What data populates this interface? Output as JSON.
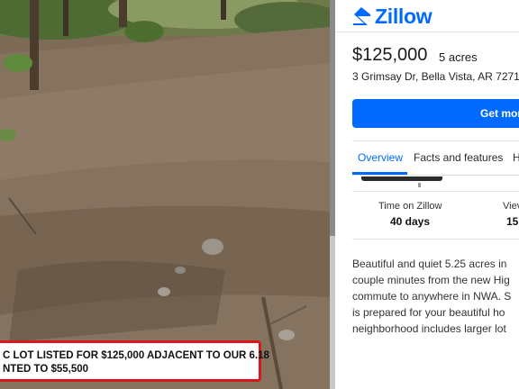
{
  "caption": {
    "line1": "C LOT LISTED FOR $125,000 ADJACENT TO OUR 6.18",
    "line2": "NTED TO $55,500"
  },
  "zillow": {
    "brand": "Zillow",
    "price": "$125,000",
    "acres": "5 acres",
    "address": "3 Grimsay Dr, Bella Vista, AR 7271",
    "cta_label": "Get mor",
    "tabs": [
      "Overview",
      "Facts and features",
      "H"
    ],
    "active_tab": "Overview",
    "stats": [
      {
        "label": "Time on Zillow",
        "value": "40 days"
      },
      {
        "label": "Viev",
        "value": "15"
      }
    ],
    "description_lines": [
      "Beautiful and quiet 5.25 acres in",
      "couple minutes from the new Hig",
      "commute to anywhere in NWA. S",
      "is prepared for your beautiful ho",
      "neighborhood includes larger lot"
    ]
  },
  "colors": {
    "accent": "#006aff",
    "caption_border": "#d9161c"
  }
}
